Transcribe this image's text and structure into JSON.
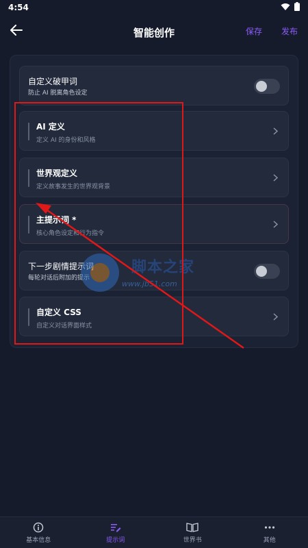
{
  "status": {
    "time": "4:54"
  },
  "header": {
    "title": "智能创作",
    "save_label": "保存",
    "publish_label": "发布"
  },
  "settings": {
    "anti_break": {
      "title": "自定义破甲词",
      "subtitle": "防止 AI 脱离角色设定",
      "enabled": false
    },
    "cards": [
      {
        "title": "AI 定义",
        "subtitle": "定义 AI 的身份和风格"
      },
      {
        "title": "世界观定义",
        "subtitle": "定义故事发生的世界观背景"
      },
      {
        "title": "主提示词 *",
        "subtitle": "核心角色设定和行为指令"
      }
    ],
    "next_step": {
      "title": "下一步剧情提示词",
      "subtitle": "每轮对话后附加的提示",
      "enabled": false
    },
    "custom_css": {
      "title": "自定义 CSS",
      "subtitle": "自定义对话界面样式"
    }
  },
  "watermark": {
    "text": "www.jb51.com",
    "brand": "脚本之家"
  },
  "tabs": [
    {
      "label": "基本信息",
      "icon": "info-icon",
      "active": false
    },
    {
      "label": "提示词",
      "icon": "edit-list-icon",
      "active": true
    },
    {
      "label": "世界书",
      "icon": "book-icon",
      "active": false
    },
    {
      "label": "其他",
      "icon": "more-icon",
      "active": false
    }
  ],
  "colors": {
    "accent": "#8b5cf6",
    "background": "#151b2b",
    "annotation": "#e01818"
  }
}
